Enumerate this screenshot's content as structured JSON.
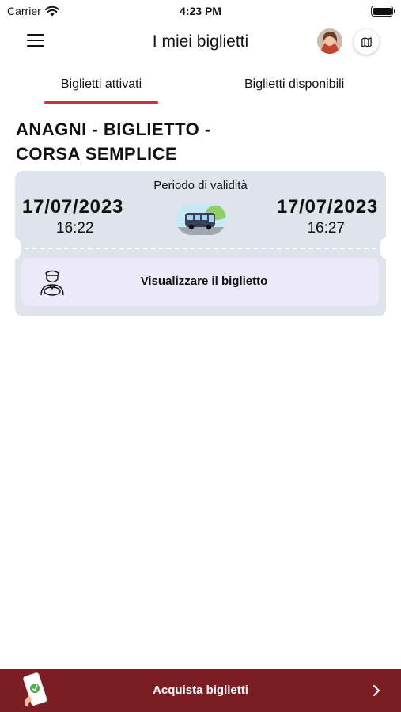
{
  "status_bar": {
    "carrier": "Carrier",
    "time": "4:23 PM"
  },
  "header": {
    "title": "I miei biglietti",
    "menu_icon": "hamburger-menu-icon",
    "map_icon": "map-icon"
  },
  "tabs": [
    {
      "label": "Biglietti attivati",
      "active": true
    },
    {
      "label": "Biglietti disponibili",
      "active": false
    }
  ],
  "ticket": {
    "title": "ANAGNI - BIGLIETTO - CORSA SEMPLICE",
    "validity_label": "Periodo di validità",
    "start_date": "17/07/2023",
    "start_time": "16:22",
    "end_date": "17/07/2023",
    "end_time": "16:27",
    "view_label": "Visualizzare il biglietto"
  },
  "bottom_bar": {
    "label": "Acquista biglietti"
  },
  "colors": {
    "tab_indicator": "#d32f3a",
    "bottom_bar": "#7b1e24",
    "ticket_background": "#dfe4ec",
    "view_button": "#ece9fb"
  }
}
